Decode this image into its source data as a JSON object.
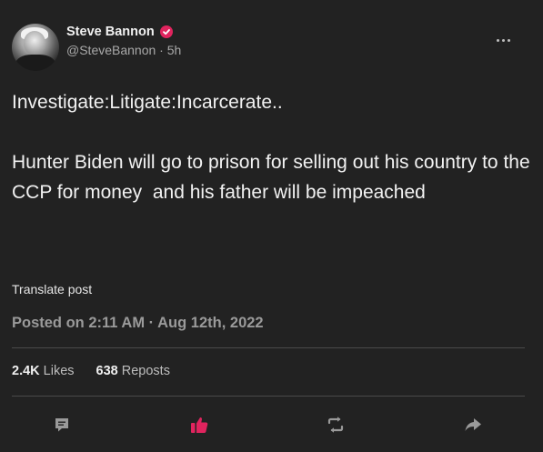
{
  "author": {
    "display_name": "Steve Bannon",
    "handle_time": "@SteveBannon · 5h",
    "verified_icon": "verified-badge-icon"
  },
  "post": {
    "text": "Investigate:Litigate:Incarcerate..\n\nHunter Biden will go to prison for selling out his country to the CCP for money  and his father will be impeached",
    "translate_label": "Translate post",
    "posted_on": "Posted on 2:11 AM · Aug 12th, 2022"
  },
  "stats": {
    "likes_count": "2.4K",
    "likes_label": "Likes",
    "reposts_count": "638",
    "reposts_label": "Reposts"
  },
  "actions": {
    "reply_icon": "comment-icon",
    "like_icon": "thumbs-up-icon",
    "repost_icon": "repost-icon",
    "share_icon": "share-arrow-icon"
  },
  "colors": {
    "background": "#222222",
    "verified": "#e0245e",
    "liked": "#e0245e",
    "muted": "#9a9a9a"
  }
}
